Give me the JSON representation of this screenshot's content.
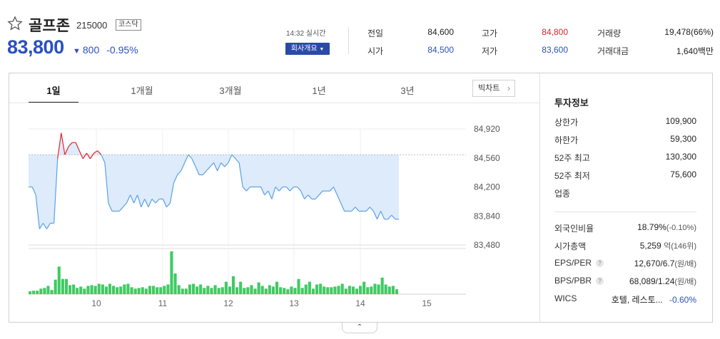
{
  "stock": {
    "name": "골프존",
    "code": "215000",
    "market": "코스닥",
    "price": "83,800",
    "change": "800",
    "change_pct": "-0.95%",
    "realtime": "14:32 실시간",
    "company_button": "회사개요"
  },
  "quote": {
    "prev_close_label": "전일",
    "prev_close": "84,600",
    "high_label": "고가",
    "high": "84,800",
    "volume_label": "거래량",
    "volume": "19,478(66%)",
    "open_label": "시가",
    "open": "84,500",
    "low_label": "저가",
    "low": "83,600",
    "amount_label": "거래대금",
    "amount": "1,640백만"
  },
  "tabs": [
    "1일",
    "1개월",
    "3개월",
    "1년",
    "3년"
  ],
  "bigchart_label": "빅차트",
  "info": {
    "title": "투자정보",
    "upper_limit_label": "상한가",
    "upper_limit": "109,900",
    "lower_limit_label": "하한가",
    "lower_limit": "59,300",
    "high52_label": "52주 최고",
    "high52": "130,300",
    "low52_label": "52주 최저",
    "low52": "75,600",
    "sector_label": "업종",
    "foreign_label": "외국인비율",
    "foreign_value": "18.79%",
    "foreign_change": "(-0.10%)",
    "mcap_label": "시가총액",
    "mcap_value": "5,259",
    "mcap_unit": "억(146위)",
    "eps_per_label": "EPS/PER",
    "eps_per_value": "12,670/6.7",
    "eps_per_unit": "(원/배)",
    "bps_pbr_label": "BPS/PBR",
    "bps_pbr_value": "68,089/1.24",
    "bps_pbr_unit": "(원/배)",
    "wics_label": "WICS",
    "wics_value": "호텔, 레스토...",
    "wics_change": "-0.60%"
  },
  "colors": {
    "up": "#e1242b",
    "down": "#2a50c0",
    "line": "#5aa0e8",
    "fill": "#ddebfb",
    "volume": "#3ecb62"
  },
  "chart_data": {
    "type": "line",
    "y_ticks": [
      "84,920",
      "84,560",
      "84,200",
      "83,840",
      "83,480"
    ],
    "ylim": [
      83480,
      84920
    ],
    "x_ticks": [
      "10",
      "11",
      "12",
      "13",
      "14",
      "15"
    ],
    "prev_close": 84600,
    "price": [
      84200,
      84200,
      84100,
      83680,
      83750,
      83680,
      83750,
      83750,
      84550,
      84870,
      84600,
      84700,
      84750,
      84750,
      84650,
      84550,
      84620,
      84550,
      84620,
      84650,
      84600,
      84500,
      84000,
      83900,
      83900,
      83900,
      83950,
      84000,
      84100,
      84000,
      84100,
      83950,
      84050,
      83950,
      84050,
      84000,
      84050,
      84050,
      83950,
      84000,
      84250,
      84350,
      84400,
      84500,
      84600,
      84550,
      84450,
      84350,
      84350,
      84400,
      84450,
      84500,
      84400,
      84500,
      84450,
      84500,
      84600,
      84550,
      84500,
      84200,
      84150,
      84200,
      84200,
      84200,
      84200,
      84100,
      84150,
      84050,
      84200,
      84150,
      84200,
      84200,
      84150,
      84200,
      84200,
      84150,
      84050,
      84100,
      84050,
      84050,
      84100,
      84150,
      84150,
      84150,
      84200,
      84100,
      84000,
      83900,
      83900,
      83900,
      83950,
      83900,
      83900,
      83900,
      83950,
      83900,
      83800,
      83900,
      83800,
      83800,
      83850,
      83800,
      83800
    ],
    "volume": [
      4,
      5,
      5,
      8,
      9,
      12,
      6,
      21,
      40,
      22,
      22,
      13,
      14,
      9,
      11,
      8,
      12,
      13,
      12,
      15,
      14,
      11,
      15,
      12,
      10,
      11,
      14,
      15,
      10,
      8,
      9,
      10,
      8,
      12,
      12,
      10,
      10,
      12,
      14,
      62,
      30,
      13,
      8,
      8,
      14,
      15,
      11,
      14,
      9,
      12,
      9,
      13,
      9,
      10,
      18,
      11,
      26,
      10,
      18,
      9,
      10,
      13,
      8,
      17,
      12,
      8,
      13,
      11,
      18,
      10,
      9,
      7,
      11,
      9,
      22,
      9,
      14,
      18,
      8,
      14,
      15,
      11,
      10,
      10,
      11,
      12,
      15,
      8,
      12,
      11,
      8,
      12,
      18,
      10,
      11,
      15,
      14,
      24,
      14,
      11,
      12,
      7
    ]
  }
}
